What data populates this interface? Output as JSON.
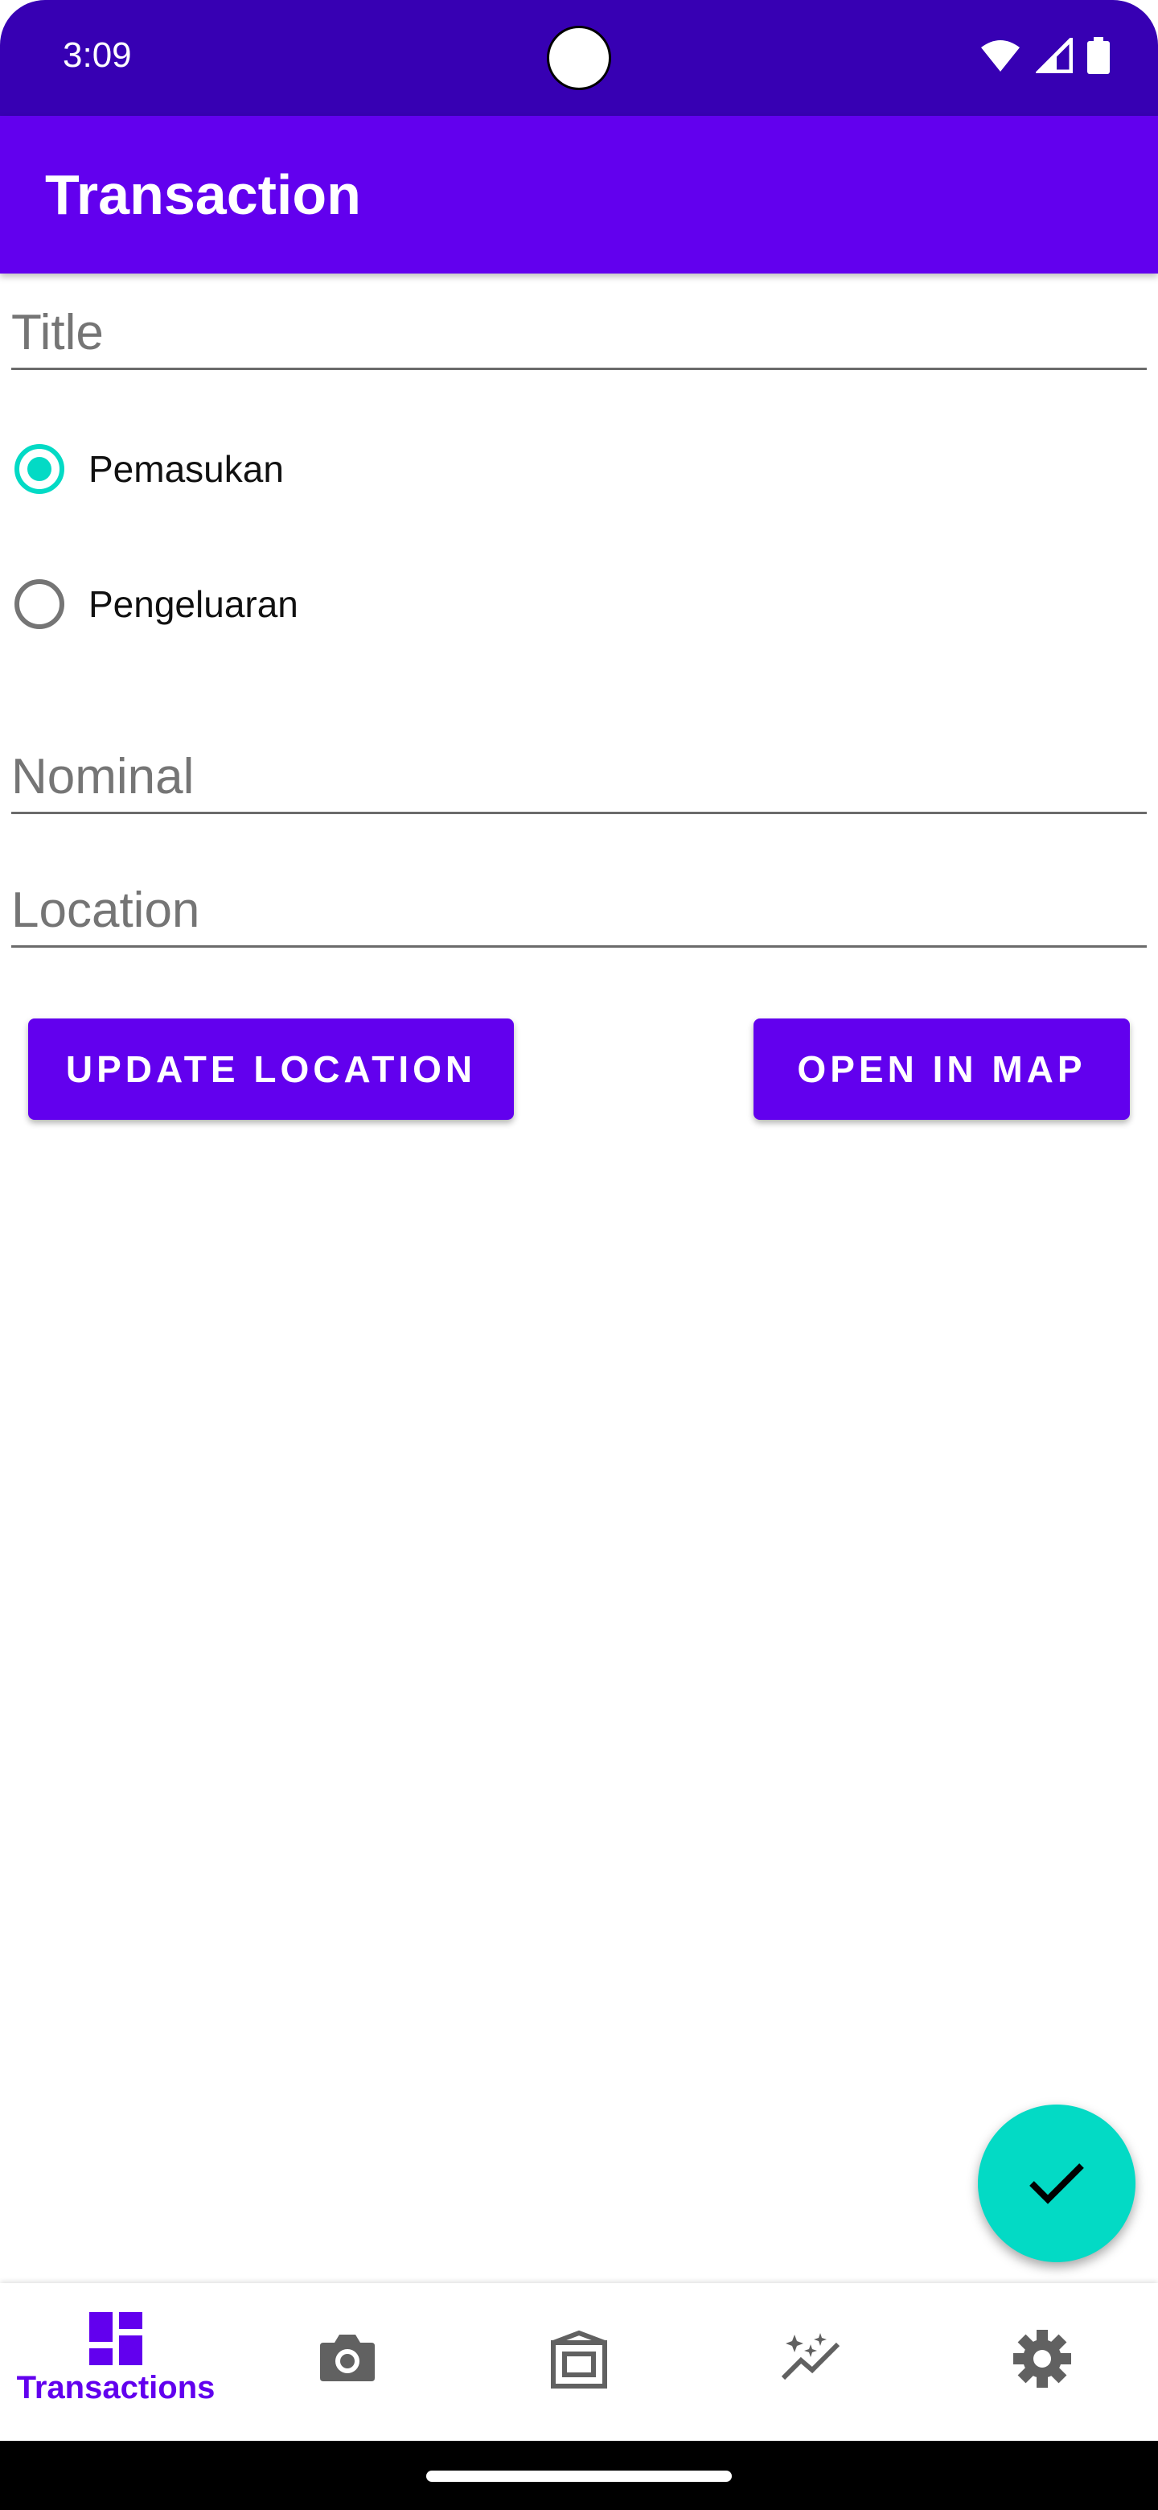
{
  "status_bar": {
    "time": "3:09"
  },
  "app_bar": {
    "title": "Transaction"
  },
  "form": {
    "title_placeholder": "Title",
    "type_options": [
      {
        "label": "Pemasukan",
        "checked": true
      },
      {
        "label": "Pengeluaran",
        "checked": false
      }
    ],
    "nominal_placeholder": "Nominal",
    "location_placeholder": "Location",
    "update_location_label": "UPDATE LOCATION",
    "open_in_map_label": "OPEN IN MAP"
  },
  "fab": {
    "icon": "check-icon"
  },
  "bottom_nav": {
    "items": [
      {
        "icon": "dashboard-icon",
        "label": "Transactions",
        "active": true
      },
      {
        "icon": "camera-icon",
        "label": "",
        "active": false
      },
      {
        "icon": "gallery-icon",
        "label": "",
        "active": false
      },
      {
        "icon": "insights-icon",
        "label": "",
        "active": false
      },
      {
        "icon": "settings-icon",
        "label": "",
        "active": false
      }
    ]
  },
  "colors": {
    "primary": "#6200EE",
    "primary_dark": "#3700B3",
    "accent": "#03DAC5"
  }
}
